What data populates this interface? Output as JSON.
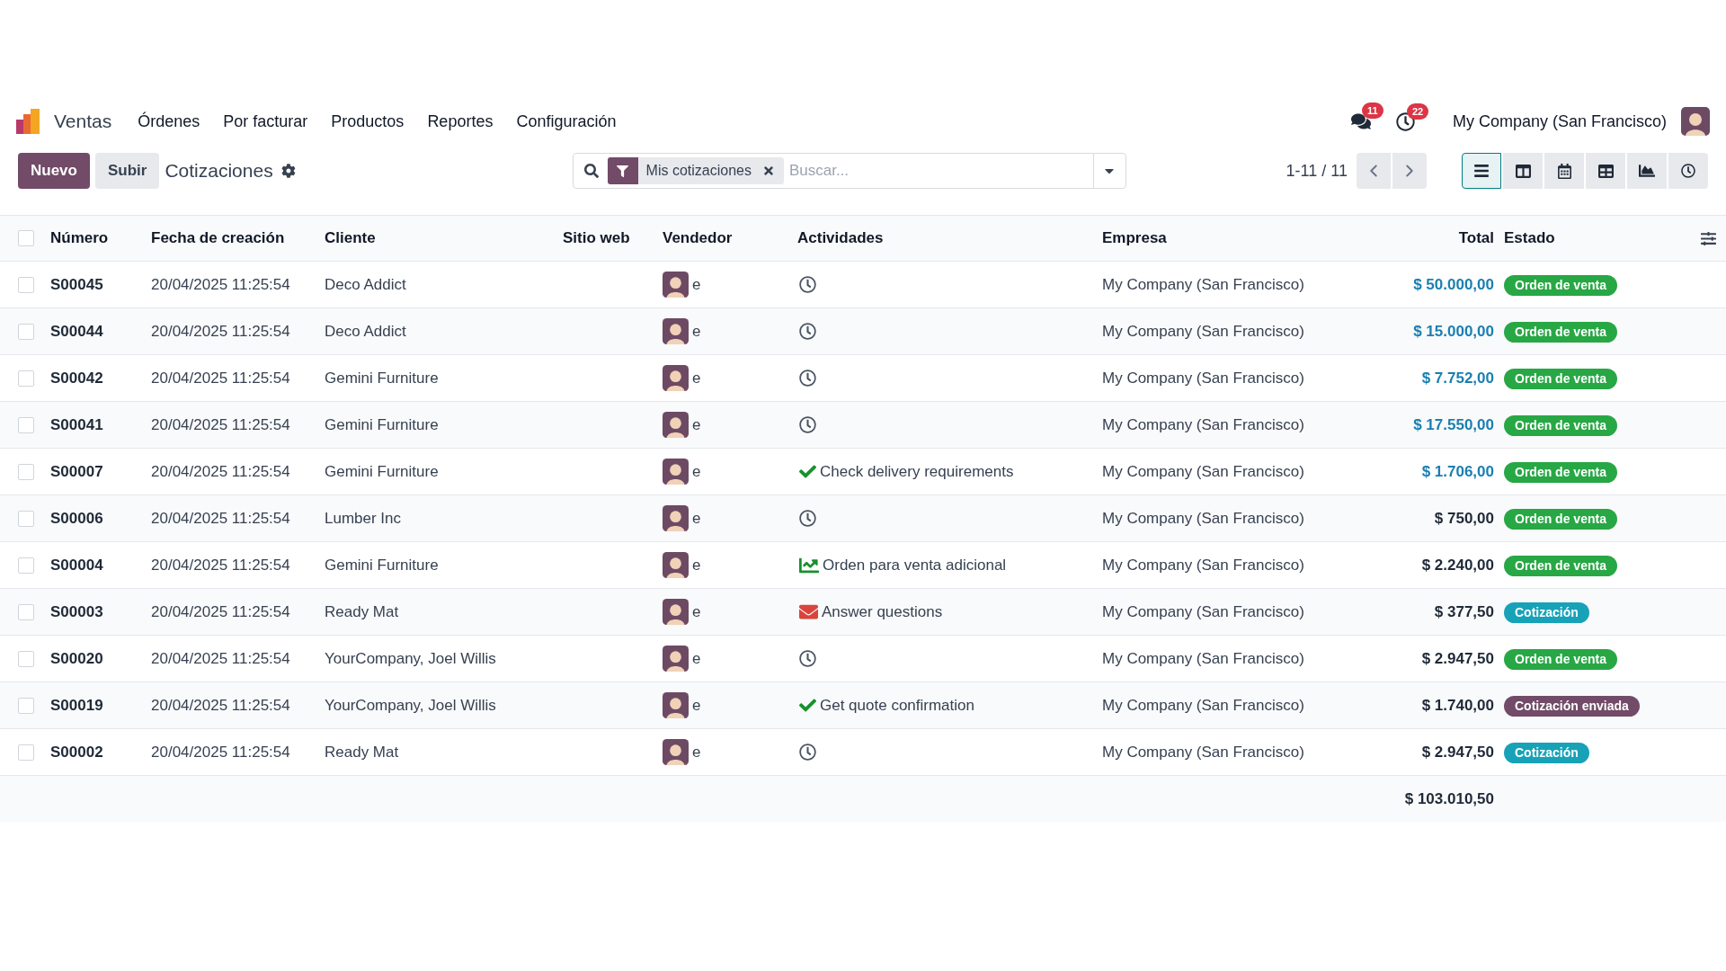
{
  "navbar": {
    "app_name": "Ventas",
    "menu": [
      "Órdenes",
      "Por facturar",
      "Productos",
      "Reportes",
      "Configuración"
    ],
    "messages_badge": "11",
    "activities_badge": "22",
    "company": "My Company (San Francisco)"
  },
  "control_panel": {
    "new_button": "Nuevo",
    "upload_button": "Subir",
    "title": "Cotizaciones",
    "search": {
      "facet": "Mis cotizaciones",
      "placeholder": "Buscar..."
    },
    "pager": "1-11 / 11",
    "views": [
      {
        "kind": "list",
        "selected": true
      },
      {
        "kind": "kanban",
        "selected": false
      },
      {
        "kind": "calendar",
        "selected": false
      },
      {
        "kind": "pivot",
        "selected": false
      },
      {
        "kind": "graph",
        "selected": false
      },
      {
        "kind": "activity",
        "selected": false
      }
    ]
  },
  "table": {
    "select_all_checked": false,
    "columns": [
      "Número",
      "Fecha de creación",
      "Cliente",
      "Sitio web",
      "Vendedor",
      "Actividades",
      "Empresa",
      "Total",
      "Estado"
    ],
    "rows": [
      {
        "checked": false,
        "number": "S00045",
        "date": "20/04/2025 11:25:54",
        "customer": "Deco Addict",
        "salesperson": "e",
        "activity": {
          "kind": "clock"
        },
        "company": "My Company (San Francisco)",
        "total": "$ 50.000,00",
        "total_highlight": true,
        "status": {
          "label": "Orden de venta",
          "kind": "sale"
        }
      },
      {
        "checked": false,
        "number": "S00044",
        "date": "20/04/2025 11:25:54",
        "customer": "Deco Addict",
        "salesperson": "e",
        "activity": {
          "kind": "clock"
        },
        "company": "My Company (San Francisco)",
        "total": "$ 15.000,00",
        "total_highlight": true,
        "status": {
          "label": "Orden de venta",
          "kind": "sale"
        }
      },
      {
        "checked": false,
        "number": "S00042",
        "date": "20/04/2025 11:25:54",
        "customer": "Gemini Furniture",
        "salesperson": "e",
        "activity": {
          "kind": "clock"
        },
        "company": "My Company (San Francisco)",
        "total": "$ 7.752,00",
        "total_highlight": true,
        "status": {
          "label": "Orden de venta",
          "kind": "sale"
        }
      },
      {
        "checked": false,
        "number": "S00041",
        "date": "20/04/2025 11:25:54",
        "customer": "Gemini Furniture",
        "salesperson": "e",
        "activity": {
          "kind": "clock"
        },
        "company": "My Company (San Francisco)",
        "total": "$ 17.550,00",
        "total_highlight": true,
        "status": {
          "label": "Orden de venta",
          "kind": "sale"
        }
      },
      {
        "checked": false,
        "number": "S00007",
        "date": "20/04/2025 11:25:54",
        "customer": "Gemini Furniture",
        "salesperson": "e",
        "activity": {
          "kind": "todo",
          "text": "Check delivery requirements"
        },
        "company": "My Company (San Francisco)",
        "total": "$ 1.706,00",
        "total_highlight": true,
        "status": {
          "label": "Orden de venta",
          "kind": "sale"
        }
      },
      {
        "checked": false,
        "number": "S00006",
        "date": "20/04/2025 11:25:54",
        "customer": "Lumber Inc",
        "salesperson": "e",
        "activity": {
          "kind": "clock"
        },
        "company": "My Company (San Francisco)",
        "total": "$ 750,00",
        "total_highlight": false,
        "status": {
          "label": "Orden de venta",
          "kind": "sale"
        }
      },
      {
        "checked": false,
        "number": "S00004",
        "date": "20/04/2025 11:25:54",
        "customer": "Gemini Furniture",
        "salesperson": "e",
        "activity": {
          "kind": "upsell",
          "text": "Orden para venta adicional"
        },
        "company": "My Company (San Francisco)",
        "total": "$ 2.240,00",
        "total_highlight": false,
        "status": {
          "label": "Orden de venta",
          "kind": "sale"
        }
      },
      {
        "checked": false,
        "number": "S00003",
        "date": "20/04/2025 11:25:54",
        "customer": "Ready Mat",
        "salesperson": "e",
        "activity": {
          "kind": "email",
          "text": "Answer questions"
        },
        "company": "My Company (San Francisco)",
        "total": "$ 377,50",
        "total_highlight": false,
        "status": {
          "label": "Cotización",
          "kind": "draft"
        }
      },
      {
        "checked": false,
        "number": "S00020",
        "date": "20/04/2025 11:25:54",
        "customer": "YourCompany, Joel Willis",
        "salesperson": "e",
        "activity": {
          "kind": "clock"
        },
        "company": "My Company (San Francisco)",
        "total": "$ 2.947,50",
        "total_highlight": false,
        "status": {
          "label": "Orden de venta",
          "kind": "sale"
        }
      },
      {
        "checked": false,
        "number": "S00019",
        "date": "20/04/2025 11:25:54",
        "customer": "YourCompany, Joel Willis",
        "salesperson": "e",
        "activity": {
          "kind": "todo",
          "text": "Get quote confirmation"
        },
        "company": "My Company (San Francisco)",
        "total": "$ 1.740,00",
        "total_highlight": false,
        "status": {
          "label": "Cotización enviada",
          "kind": "sent"
        }
      },
      {
        "checked": false,
        "number": "S00002",
        "date": "20/04/2025 11:25:54",
        "customer": "Ready Mat",
        "salesperson": "e",
        "activity": {
          "kind": "clock"
        },
        "company": "My Company (San Francisco)",
        "total": "$ 2.947,50",
        "total_highlight": false,
        "status": {
          "label": "Cotización",
          "kind": "draft"
        }
      }
    ],
    "footer_total": "$ 103.010,50"
  }
}
